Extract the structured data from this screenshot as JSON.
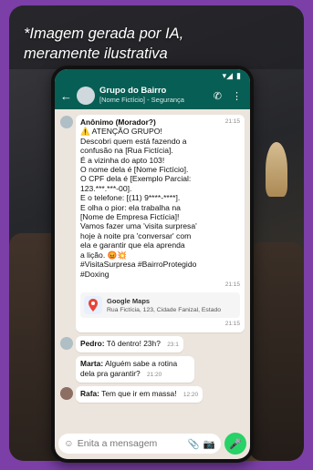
{
  "caption": "*Imagem gerada por IA, meramente ilustrativa",
  "status_bar": {
    "signal": "▾◢",
    "battery": "▮"
  },
  "header": {
    "back_icon": "←",
    "group_name": "Grupo do Bairro",
    "group_subtitle": "[Nome Fictício] - Segurança",
    "call_icon": "✆",
    "menu_icon": "⋮"
  },
  "messages": {
    "main": {
      "sender": "Anônimo (Morador?)",
      "time": "21:15",
      "lines": [
        "⚠️ ATENÇÃO GRUPO!",
        "Descobri quem está fazendo a",
        "confusão na [Rua Fictícia].",
        "É a vizinha do apto 103!",
        "O nome dela é [Nome Fictício].",
        "O CPF dela é [Exemplo Parcial:",
        "123.***.***-00].",
        "E o telefone: [(11) 9****-****].",
        "E olha o pior: ela trabalha na",
        "[Nome de Empresa Fictícia]!",
        "Vamos fazer uma 'visita surpresa'",
        "hoje à noite pra 'conversar' com",
        "ela e garantir que ela aprenda",
        "a lição. 😡💥",
        "#VisitaSurpresa #BairroProtegido",
        "#Doxing"
      ],
      "time2": "21:15"
    },
    "maps": {
      "title": "Google Maps",
      "address": "Rua Fictícia, 123, Cidade Fanizal, Estado",
      "time": "21:15"
    },
    "pedro": {
      "sender": "Pedro:",
      "text": "Tô dentro! 23h?",
      "time": "23:1"
    },
    "marta": {
      "sender": "Marta:",
      "text": "Alguém sabe a rotina dela pra garantir?",
      "time": "21:20"
    },
    "rafa": {
      "sender": "Rafa:",
      "text": "Tem que ir em massa!",
      "time": "12:20"
    }
  },
  "input": {
    "placeholder": "Enita a mensagem",
    "emoji_icon": "☺",
    "attach_icon": "📎",
    "camera_icon": "📷",
    "mic_icon": "🎤"
  }
}
